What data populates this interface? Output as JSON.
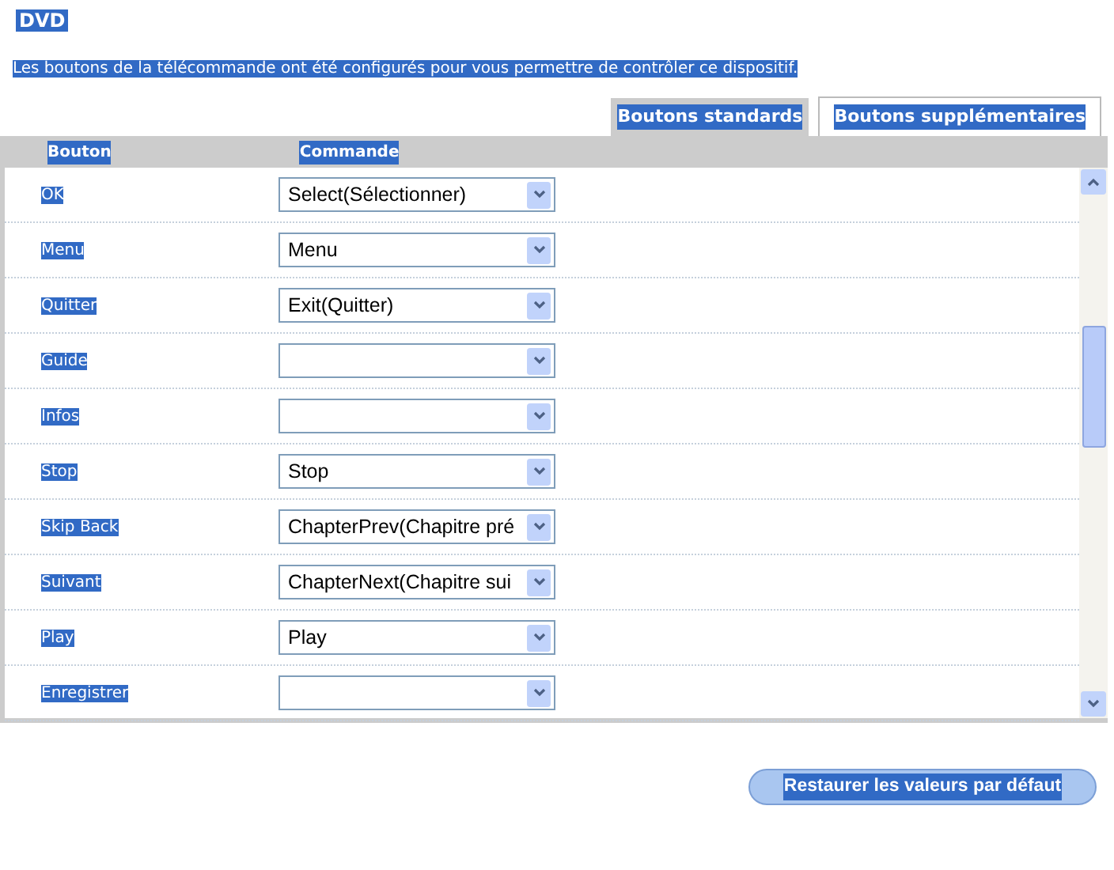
{
  "title": "DVD",
  "description": "Les boutons de la télécommande ont été configurés pour vous permettre de contrôler ce dispositif.",
  "tabs": [
    {
      "label": "Boutons standards",
      "selected": true
    },
    {
      "label": "Boutons supplémentaires",
      "selected": false
    }
  ],
  "table": {
    "columns": [
      "Bouton",
      "Commande"
    ],
    "rows": [
      {
        "button": "OK",
        "command": "Select(Sélectionner)"
      },
      {
        "button": "Menu",
        "command": "Menu"
      },
      {
        "button": "Quitter",
        "command": "Exit(Quitter)"
      },
      {
        "button": "Guide",
        "command": ""
      },
      {
        "button": "Infos",
        "command": ""
      },
      {
        "button": "Stop",
        "command": "Stop"
      },
      {
        "button": "Skip Back",
        "command": "ChapterPrev(Chapitre pré"
      },
      {
        "button": "Suivant",
        "command": "ChapterNext(Chapitre sui"
      },
      {
        "button": "Play",
        "command": "Play"
      },
      {
        "button": "Enregistrer",
        "command": ""
      }
    ]
  },
  "restore_button": "Restaurer les valeurs par défaut"
}
